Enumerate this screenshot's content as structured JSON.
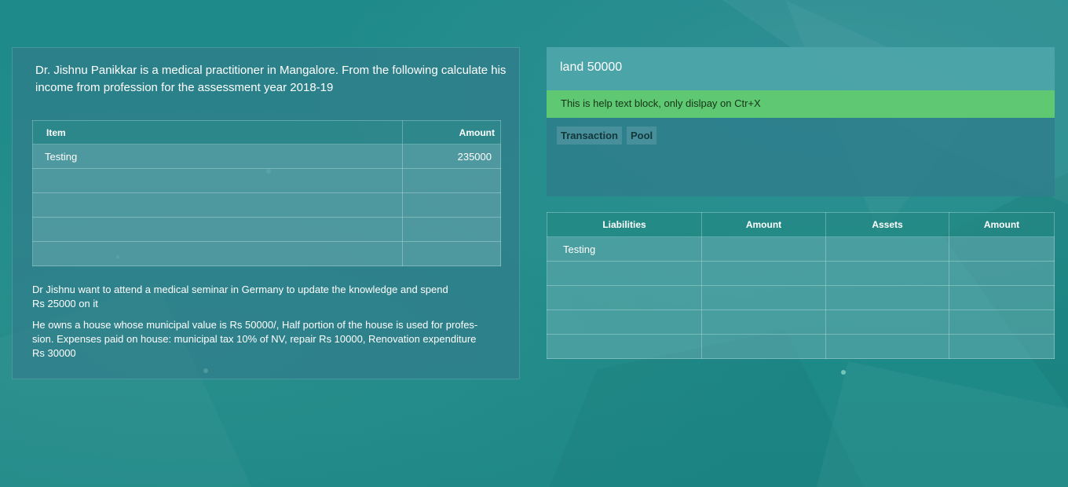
{
  "question": {
    "text": "Dr. Jishnu Panikkar is a medical practitioner in Mangalore. From the following calculate his income from profession for the assessment year 2018-19",
    "table": {
      "headers": [
        "Item",
        "Amount"
      ],
      "rows": [
        [
          "Testing",
          "235000"
        ],
        [
          "",
          ""
        ],
        [
          "",
          ""
        ],
        [
          "",
          ""
        ],
        [
          "",
          ""
        ]
      ]
    },
    "notes": [
      "Dr Jishnu want to attend a medical seminar in Germany to update the knowledge and spend Rs 25000 on it",
      "He owns a house whose municipal value is Rs 50000/, Half portion of the house is used for profes-sion. Expenses paid on house: municipal tax 10% of NV, repair Rs 10000, Renovation expenditure Rs 30000"
    ]
  },
  "answer": {
    "header_text": "land 50000",
    "help_text": "This is help text block, only dislpay on Ctr+X",
    "tags": [
      "Transaction",
      "Pool"
    ]
  },
  "balance_sheet": {
    "headers": [
      "Liabilities",
      "Amount",
      "Assets",
      "Amount"
    ],
    "rows": [
      [
        "Testing",
        "",
        "",
        ""
      ],
      [
        "",
        "",
        "",
        ""
      ],
      [
        "",
        "",
        "",
        ""
      ],
      [
        "",
        "",
        "",
        ""
      ],
      [
        "",
        "",
        "",
        ""
      ]
    ]
  },
  "colors": {
    "background": "#1f8a88",
    "help_bar": "#5ec972",
    "header": "#50a8ac"
  }
}
